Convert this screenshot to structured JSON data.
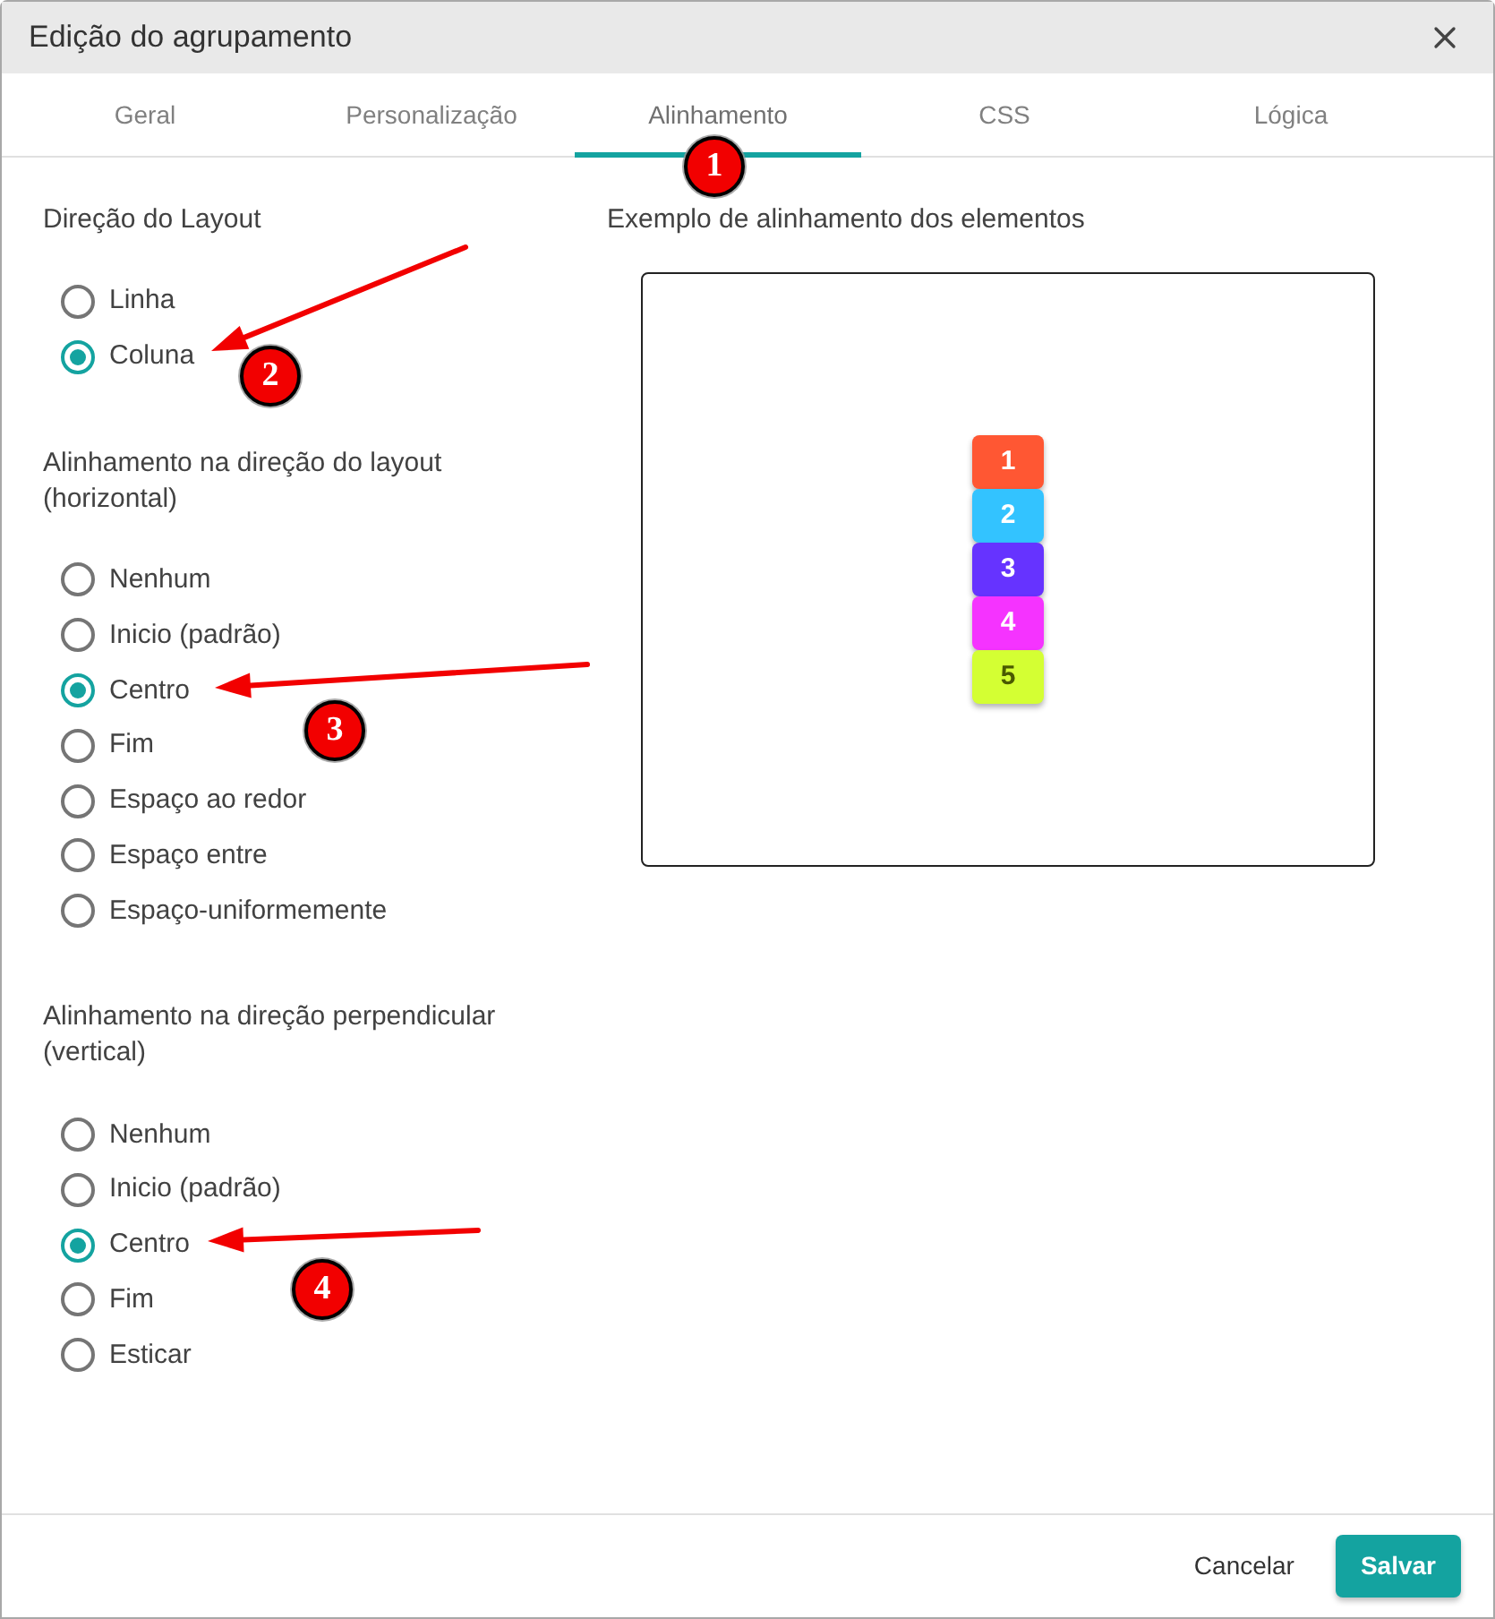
{
  "window": {
    "title": "Edição do agrupamento"
  },
  "tabs": [
    {
      "label": "Geral",
      "selected": false
    },
    {
      "label": "Personalização",
      "selected": false
    },
    {
      "label": "Alinhamento",
      "selected": true
    },
    {
      "label": "CSS",
      "selected": false
    },
    {
      "label": "Lógica",
      "selected": false
    }
  ],
  "layout_direction": {
    "label": "Direção do Layout",
    "options": [
      {
        "label": "Linha",
        "selected": false
      },
      {
        "label": "Coluna",
        "selected": true
      }
    ]
  },
  "main_axis_alignment": {
    "label": "Alinhamento na direção do layout (horizontal)",
    "options": [
      {
        "label": "Nenhum",
        "selected": false
      },
      {
        "label": "Inicio (padrão)",
        "selected": false
      },
      {
        "label": "Centro",
        "selected": true
      },
      {
        "label": "Fim",
        "selected": false
      },
      {
        "label": "Espaço ao redor",
        "selected": false
      },
      {
        "label": "Espaço entre",
        "selected": false
      },
      {
        "label": "Espaço-uniformemente",
        "selected": false
      }
    ]
  },
  "cross_axis_alignment": {
    "label": "Alinhamento na direção perpendicular (vertical)",
    "options": [
      {
        "label": "Nenhum",
        "selected": false
      },
      {
        "label": "Inicio (padrão)",
        "selected": false
      },
      {
        "label": "Centro",
        "selected": true
      },
      {
        "label": "Fim",
        "selected": false
      },
      {
        "label": "Esticar",
        "selected": false
      }
    ]
  },
  "preview": {
    "label": "Exemplo de alinhamento dos elementos",
    "items": [
      {
        "label": "1",
        "color": "#ff5733"
      },
      {
        "label": "2",
        "color": "#33c3ff"
      },
      {
        "label": "3",
        "color": "#6633ff"
      },
      {
        "label": "4",
        "color": "#f533ff"
      },
      {
        "label": "5",
        "color": "#d4ff33"
      }
    ]
  },
  "buttons": [
    {
      "label": "Cancelar",
      "kind": "text"
    },
    {
      "label": "Salvar",
      "kind": "primary"
    }
  ],
  "annotations": [
    {
      "label": "1",
      "arrow": false
    },
    {
      "label": "2",
      "arrow": true
    },
    {
      "label": "3",
      "arrow": true
    },
    {
      "label": "4",
      "arrow": true
    }
  ]
}
